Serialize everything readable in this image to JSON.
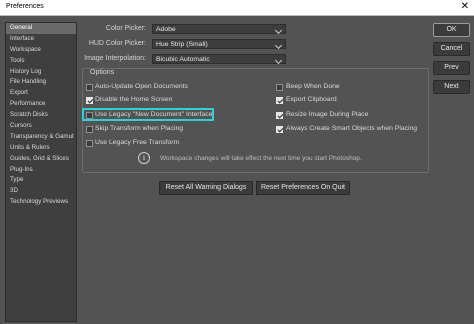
{
  "window": {
    "title": "Preferences",
    "close_glyph": "✕"
  },
  "sidebar": {
    "items": [
      {
        "label": "General",
        "selected": true
      },
      {
        "label": "Interface"
      },
      {
        "label": "Workspace"
      },
      {
        "label": "Tools"
      },
      {
        "label": "History Log"
      },
      {
        "label": "File Handling"
      },
      {
        "label": "Export"
      },
      {
        "label": "Performance"
      },
      {
        "label": "Scratch Disks"
      },
      {
        "label": "Cursors"
      },
      {
        "label": "Transparency & Gamut"
      },
      {
        "label": "Units & Rulers"
      },
      {
        "label": "Guides, Grid & Slices"
      },
      {
        "label": "Plug-Ins"
      },
      {
        "label": "Type"
      },
      {
        "label": "3D"
      },
      {
        "label": "Technology Previews"
      }
    ]
  },
  "general": {
    "color_picker": {
      "label": "Color Picker:",
      "value": "Adobe"
    },
    "hud_color_picker": {
      "label": "HUD Color Picker:",
      "value": "Hue Strip (Small)"
    },
    "image_interpolation": {
      "label": "Image Interpolation:",
      "value": "Bicubic Automatic"
    }
  },
  "options": {
    "title": "Options",
    "left": [
      {
        "label": "Auto-Update Open Documents",
        "checked": false
      },
      {
        "label": "Disable the Home Screen",
        "checked": true
      },
      {
        "label": "Use Legacy \"New Document\" Interface",
        "checked": false
      },
      {
        "label": "Skip Transform when Placing",
        "checked": false
      },
      {
        "label": "Use Legacy Free Transform",
        "checked": false
      }
    ],
    "right": [
      {
        "label": "Beep When Done",
        "checked": false
      },
      {
        "label": "Export Clipboard",
        "checked": true
      },
      {
        "label": "Resize Image During Place",
        "checked": true
      },
      {
        "label": "Always Create Smart Objects when Placing",
        "checked": true
      }
    ],
    "info_icon": "i",
    "note": "Workspace changes will take effect the next time you start Photoshop."
  },
  "bottom_buttons": {
    "reset_warnings": "Reset All Warning Dialogs",
    "reset_prefs": "Reset Preferences On Quit"
  },
  "right_buttons": {
    "ok": "OK",
    "cancel": "Cancel",
    "prev": "Prev",
    "next": "Next"
  }
}
